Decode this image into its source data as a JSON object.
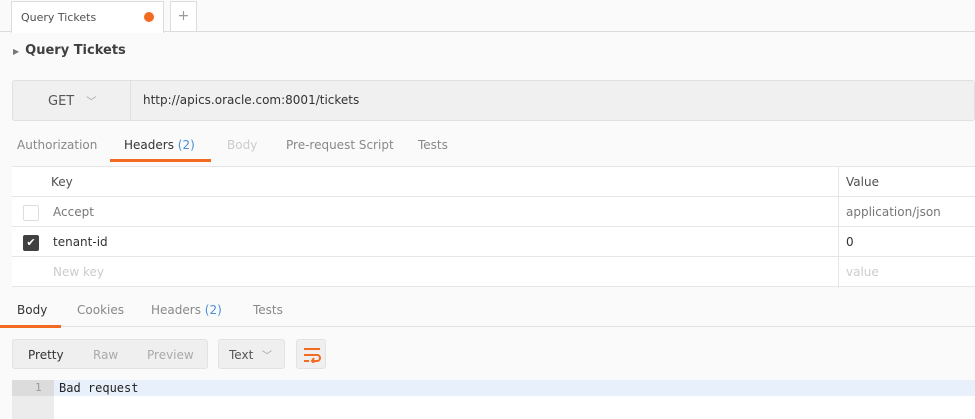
{
  "tabs": [
    {
      "label": "Query Tickets",
      "unsaved": true
    }
  ],
  "new_tab_label": "+",
  "request": {
    "title": "Query Tickets",
    "method": "GET",
    "url": "http://apics.oracle.com:8001/tickets"
  },
  "request_tabs": [
    {
      "label": "Authorization"
    },
    {
      "label": "Headers",
      "count": "(2)"
    },
    {
      "label": "Body"
    },
    {
      "label": "Pre-request Script"
    },
    {
      "label": "Tests"
    }
  ],
  "headers_table": {
    "columns": [
      "Key",
      "Value"
    ],
    "rows": [
      {
        "key": "Accept",
        "value": "application/json",
        "checked": false
      },
      {
        "key": "tenant-id",
        "value": "0",
        "checked": true
      }
    ],
    "placeholder_key": "New key",
    "placeholder_value": "value"
  },
  "response_tabs": [
    {
      "label": "Body"
    },
    {
      "label": "Cookies"
    },
    {
      "label": "Headers",
      "count": "(2)"
    },
    {
      "label": "Tests"
    }
  ],
  "view_modes": [
    "Pretty",
    "Raw",
    "Preview"
  ],
  "format": "Text",
  "response_body": {
    "line_number": "1",
    "text": "Bad request"
  },
  "colors": {
    "accent": "#f26b21",
    "link": "#4a90d9"
  }
}
